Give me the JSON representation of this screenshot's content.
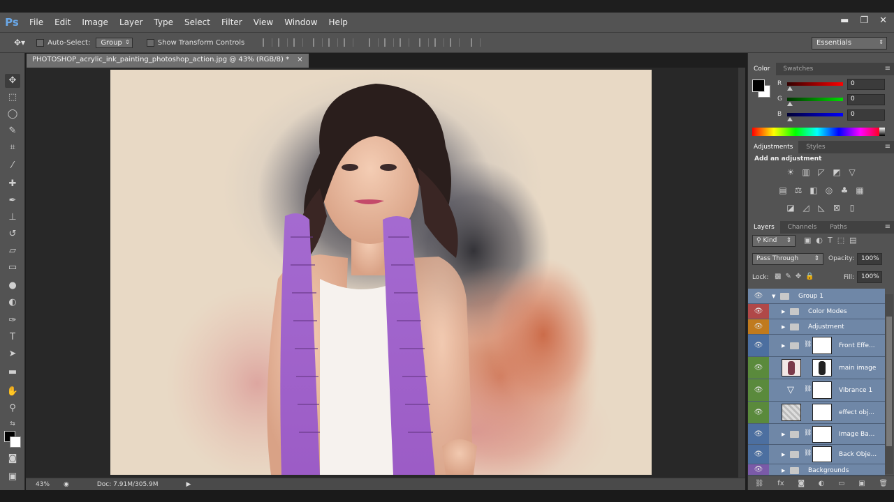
{
  "app": {
    "logo": "Ps"
  },
  "menu": [
    "File",
    "Edit",
    "Image",
    "Layer",
    "Type",
    "Select",
    "Filter",
    "View",
    "Window",
    "Help"
  ],
  "window_controls": {
    "minimize": "▬",
    "restore": "❐",
    "close": "✕"
  },
  "options": {
    "auto_select_label": "Auto-Select:",
    "auto_select_value": "Group",
    "transform_label": "Show Transform Controls",
    "workspace": "Essentials"
  },
  "document": {
    "tab_title": "PHOTOSHOP_acrylic_ink_painting_photoshop_action.jpg @ 43% (RGB/8) *",
    "tab_close": "×",
    "zoom": "43%",
    "doc_info": "Doc: 7.91M/305.9M"
  },
  "color_panel": {
    "tabs": [
      "Color",
      "Swatches"
    ],
    "channels": [
      {
        "label": "R",
        "value": "0",
        "color": "#e02020"
      },
      {
        "label": "G",
        "value": "0",
        "color": "#20c020"
      },
      {
        "label": "B",
        "value": "0",
        "color": "#2020e0"
      }
    ]
  },
  "adjustments_panel": {
    "tabs": [
      "Adjustments",
      "Styles"
    ],
    "heading": "Add an adjustment"
  },
  "layers_panel": {
    "tabs": [
      "Layers",
      "Channels",
      "Paths"
    ],
    "kind": "Kind",
    "blend_mode": "Pass Through",
    "opacity_label": "Opacity:",
    "opacity": "100%",
    "lock_label": "Lock:",
    "fill_label": "Fill:",
    "fill": "100%",
    "layers": [
      {
        "name": "Group 1",
        "tag_color": "#6f87a7"
      },
      {
        "name": "Color Modes",
        "tag_color": "#b04848"
      },
      {
        "name": "Adjustment",
        "tag_color": "#c07a1e"
      },
      {
        "name": "Front Effe...",
        "tag_color": "#4c6fa0"
      },
      {
        "name": "main image",
        "tag_color": "#5a8a3c"
      },
      {
        "name": "Vibrance 1",
        "tag_color": "#5a8a3c"
      },
      {
        "name": "effect obj...",
        "tag_color": "#5a8a3c"
      },
      {
        "name": "Image Ba...",
        "tag_color": "#4c6fa0"
      },
      {
        "name": "Back Obje...",
        "tag_color": "#4c6fa0"
      },
      {
        "name": "Backgrounds",
        "tag_color": "#7a5aa8"
      }
    ]
  }
}
